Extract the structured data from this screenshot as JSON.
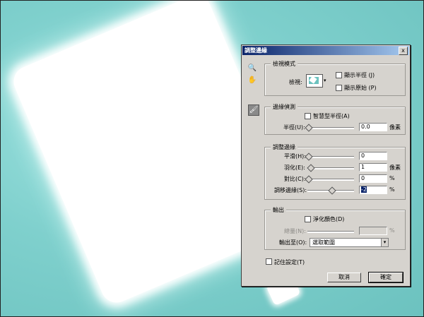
{
  "dialog": {
    "title": "調整邊緣",
    "close": "x",
    "tools": {
      "zoom": "🔍",
      "hand": "✋",
      "brush": "🖌"
    },
    "view_mode": {
      "legend": "檢視模式",
      "view_label": "檢視:",
      "show_radius": "顯示半徑 (J)",
      "show_original": "顯示原始 (P)"
    },
    "edge_detection": {
      "legend": "邊緣偵測",
      "smart_radius": "智慧型半徑(A)",
      "radius_label": "半徑(U):",
      "radius_value": "0.0",
      "radius_unit": "像素"
    },
    "adjust_edge": {
      "legend": "調整邊緣",
      "smooth_label": "平滑(H):",
      "smooth_value": "0",
      "feather_label": "羽化(E):",
      "feather_value": "1",
      "feather_unit": "像素",
      "contrast_label": "對比(C):",
      "contrast_value": "0",
      "contrast_unit": "%",
      "shift_label": "調移邊緣(S):",
      "shift_value": "-2",
      "shift_unit": "%"
    },
    "output": {
      "legend": "輸出",
      "decontaminate": "淨化顏色(D)",
      "amount_label": "總量(N):",
      "amount_unit": "%",
      "output_to_label": "輸出至(O):",
      "output_to_value": "選取範圍"
    },
    "remember": "記住設定(T)",
    "cancel": "取消",
    "ok": "確定"
  },
  "colors": {
    "title_start": "#0a246a",
    "title_end": "#a6caf0",
    "background": "#7fd0cd"
  }
}
